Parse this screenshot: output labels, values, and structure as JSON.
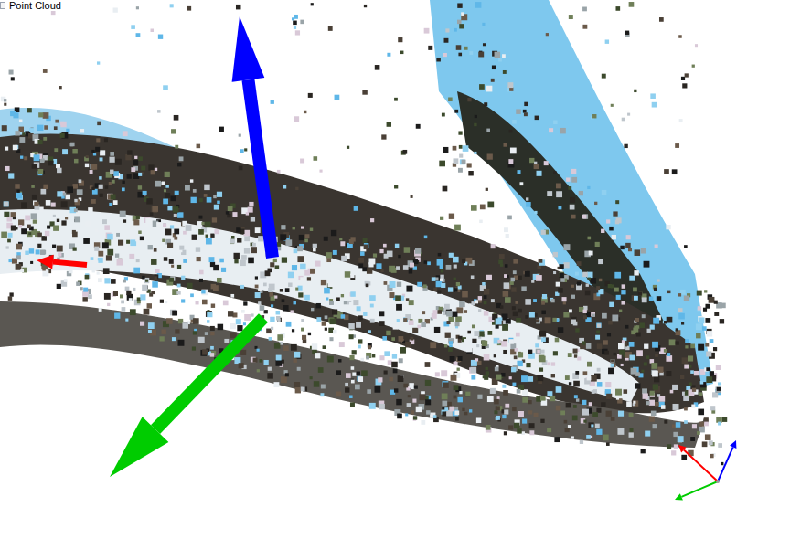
{
  "window": {
    "title": "Point Cloud"
  },
  "axes": [
    {
      "color": "#ff0000"
    },
    {
      "color": "#00cc00"
    },
    {
      "color": "#0000ff"
    }
  ]
}
